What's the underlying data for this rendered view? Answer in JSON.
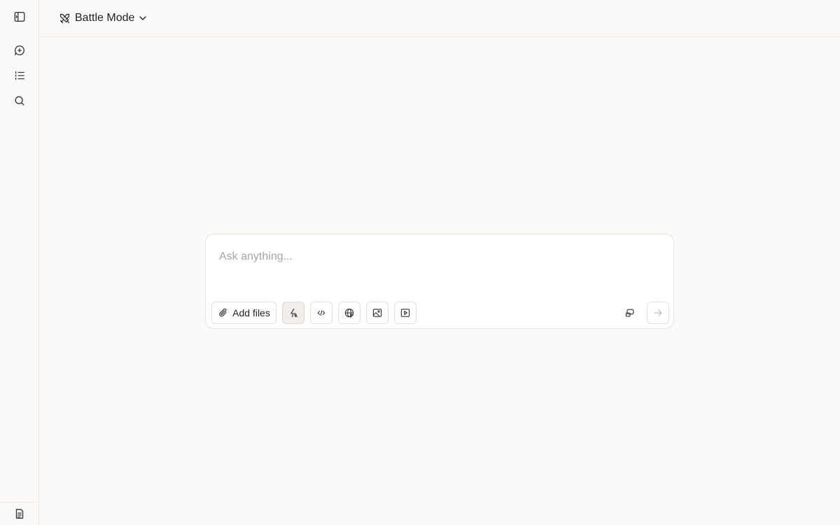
{
  "sidebar": {
    "items": [
      {
        "name": "toggle-sidebar",
        "icon": "sidebar-toggle-icon"
      },
      {
        "name": "new-chat",
        "icon": "new-chat-icon"
      },
      {
        "name": "history",
        "icon": "list-icon"
      },
      {
        "name": "search",
        "icon": "search-icon"
      }
    ],
    "bottom_icon": "document-icon"
  },
  "header": {
    "mode_label": "Battle Mode",
    "mode_icon": "swords-icon"
  },
  "composer": {
    "placeholder": "Ask anything...",
    "value": "",
    "add_files_label": "Add files",
    "tools": [
      {
        "name": "auto-mode",
        "icon": "bolt-icon",
        "active": true
      },
      {
        "name": "code",
        "icon": "code-icon",
        "active": false
      },
      {
        "name": "web-search",
        "icon": "globe-icon",
        "active": false
      },
      {
        "name": "image",
        "icon": "image-icon",
        "active": false
      },
      {
        "name": "video",
        "icon": "video-icon",
        "active": false
      }
    ],
    "right_tools": [
      {
        "name": "model-select",
        "icon": "model-icon"
      },
      {
        "name": "send",
        "icon": "arrow-right-icon"
      }
    ]
  },
  "colors": {
    "background": "#fbfaf9",
    "border": "#ece9e5",
    "placeholder": "#a8a6a3"
  }
}
